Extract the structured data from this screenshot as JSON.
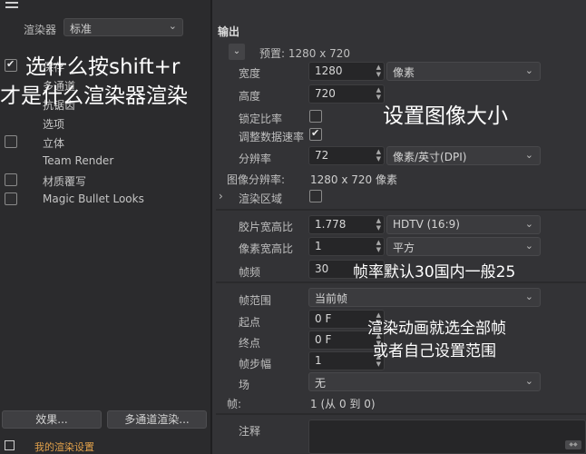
{
  "left_panel": {
    "renderer_label": "渲染器",
    "renderer_value": "标准",
    "tree_items": [
      {
        "label": "保存",
        "checkbox": true,
        "checked": true
      },
      {
        "label": "多通道",
        "checkbox": false,
        "checked": false
      },
      {
        "label": "抗锯齿",
        "checkbox": false,
        "checked": false
      },
      {
        "label": "选项",
        "checkbox": false,
        "checked": false
      },
      {
        "label": "立体",
        "checkbox": true,
        "checked": false
      },
      {
        "label": "Team Render",
        "checkbox": false,
        "checked": false
      },
      {
        "label": "材质覆写",
        "checkbox": true,
        "checked": false
      },
      {
        "label": "Magic Bullet Looks",
        "checkbox": true,
        "checked": false
      }
    ],
    "effects_button": "效果...",
    "multipass_button": "多通道渲染...",
    "render_setting_name": "我的渲染设置"
  },
  "output": {
    "title": "输出",
    "preset": "预置: 1280 x 720",
    "width_label": "宽度",
    "width_value": "1280",
    "width_unit": "像素",
    "height_label": "高度",
    "height_value": "720",
    "lock_ratio_label": "锁定比率",
    "adjust_rate_label": "调整数据速率",
    "resolution_label": "分辨率",
    "resolution_value": "72",
    "resolution_unit": "像素/英寸(DPI)",
    "image_resolution_label": "图像分辨率:",
    "image_resolution_value": "1280 x 720 像素",
    "render_region_label": "渲染区域",
    "film_aspect_label": "胶片宽高比",
    "film_aspect_value": "1.778",
    "film_aspect_preset": "HDTV (16:9)",
    "pixel_aspect_label": "像素宽高比",
    "pixel_aspect_value": "1",
    "pixel_aspect_preset": "平方",
    "fps_label": "帧频",
    "fps_value": "30",
    "frame_range_label": "帧范围",
    "frame_range_value": "当前帧",
    "start_label": "起点",
    "start_value": "0 F",
    "end_label": "终点",
    "end_value": "0 F",
    "frame_step_label": "帧步幅",
    "frame_step_value": "1",
    "field_label": "场",
    "field_value": "无",
    "frames_label": "帧:",
    "frames_value": "1 (从 0 到 0)",
    "notes_label": "注释"
  },
  "annotations": {
    "line1": "选什么按shift+r",
    "line2": "才是什么渲染器渲染",
    "size": "设置图像大小",
    "fps": "帧率默认30国内一般25",
    "anim1": "渲染动画就选全部帧",
    "anim2": "或者自己设置范围"
  }
}
